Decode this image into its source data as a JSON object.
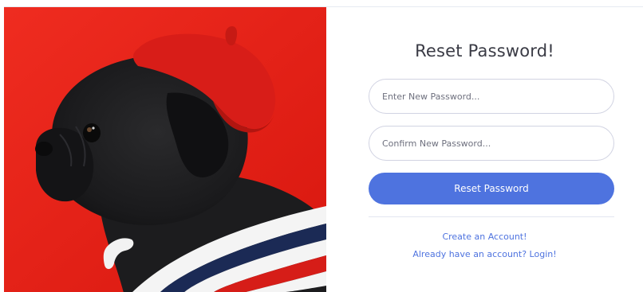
{
  "form": {
    "title": "Reset Password!",
    "new_password_placeholder": "Enter New Password...",
    "confirm_password_placeholder": "Confirm New Password...",
    "submit_label": "Reset Password"
  },
  "links": {
    "create_account": "Create an Account!",
    "login": "Already have an account? Login!"
  },
  "colors": {
    "accent": "#4e73df",
    "hero_background": "#e8251a",
    "beret": "#d81d18",
    "text_dark": "#3a3b45"
  },
  "hero": {
    "icon": "pug-in-beret-illustration"
  }
}
